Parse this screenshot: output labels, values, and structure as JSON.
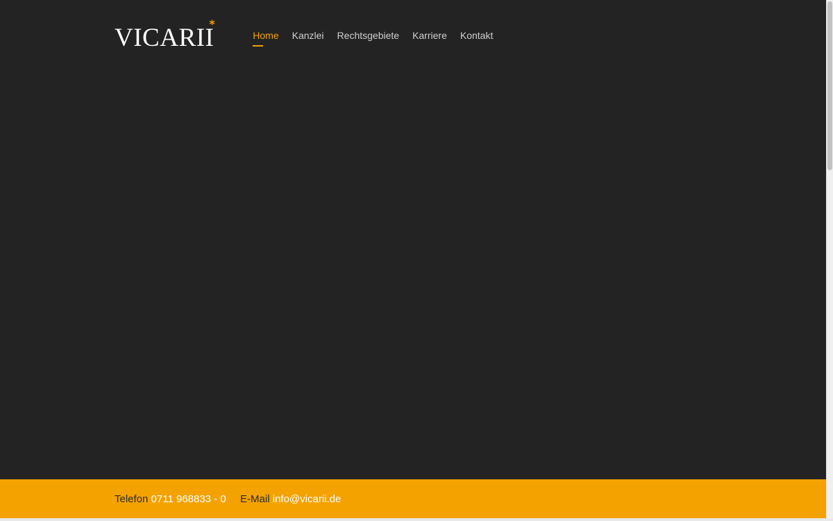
{
  "brand": {
    "logo_text": "VICARII",
    "logo_mark": "*",
    "accent_color": "#f2a200",
    "background_color": "#232323"
  },
  "nav": {
    "items": [
      {
        "label": "Home",
        "active": true
      },
      {
        "label": "Kanzlei",
        "active": false
      },
      {
        "label": "Rechtsgebiete",
        "active": false
      },
      {
        "label": "Karriere",
        "active": false
      },
      {
        "label": "Kontakt",
        "active": false
      }
    ]
  },
  "footer": {
    "phone_label": "Telefon",
    "phone_value": "0711 968833 - 0",
    "email_label": "E-Mail",
    "email_value": "info@vicarii.de",
    "bar_color": "#f4a200"
  }
}
